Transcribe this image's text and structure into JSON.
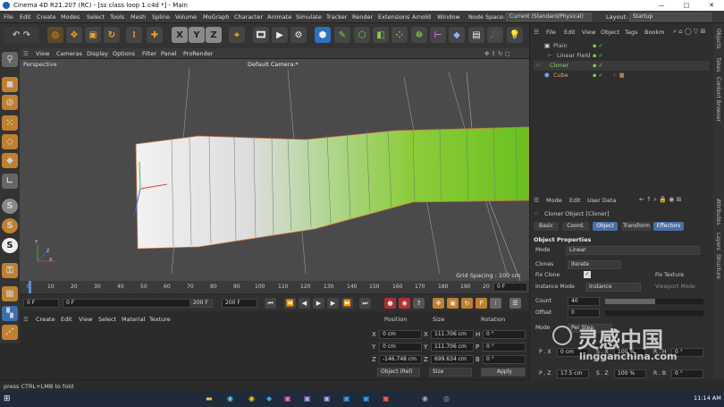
{
  "window": {
    "title": "Cinema 4D R21.207 (RC) - [ss class loop 1.c4d *] - Main",
    "min": "—",
    "max": "□",
    "close": "✕"
  },
  "menu": {
    "items": [
      "File",
      "Edit",
      "Create",
      "Modes",
      "Select",
      "Tools",
      "Mesh",
      "Spline",
      "Volume",
      "MoGraph",
      "Character",
      "Animate",
      "Simulate",
      "Tracker",
      "Render",
      "Extensions",
      "Arnold",
      "Window"
    ],
    "node_space_label": "Node Space:",
    "node_space_value": "Current (Standard/Physical)",
    "layout_label": "Layout:",
    "layout_value": "Startup"
  },
  "viewport": {
    "menu": [
      "View",
      "Cameras",
      "Display",
      "Options",
      "Filter",
      "Panel",
      "ProRender"
    ],
    "name": "Perspective",
    "camera": "Default Camera:*",
    "grid": "Grid Spacing : 100 cm",
    "axis_z": "Z",
    "axis_x": "X",
    "axis_y": "Y"
  },
  "timeline": {
    "ticks": [
      "0",
      "10",
      "20",
      "30",
      "40",
      "50",
      "60",
      "70",
      "80",
      "90",
      "100",
      "110",
      "120",
      "130",
      "140",
      "150",
      "160",
      "170",
      "180",
      "190",
      "20"
    ],
    "current": "0 F"
  },
  "transport": {
    "start": "0 F",
    "current": "0 F",
    "end1": "200 F",
    "end2": "200 F"
  },
  "materials": {
    "menu": [
      "Create",
      "Edit",
      "View",
      "Select",
      "Material",
      "Texture"
    ]
  },
  "coords": {
    "headers": [
      "Position",
      "Size",
      "Rotation"
    ],
    "rows": [
      {
        "axis": "X",
        "pos": "0 cm",
        "saxis": "X",
        "size": "111.706 cm",
        "raxis": "H",
        "rot": "0 °"
      },
      {
        "axis": "Y",
        "pos": "0 cm",
        "saxis": "Y",
        "size": "111.706 cm",
        "raxis": "P",
        "rot": "0 °"
      },
      {
        "axis": "Z",
        "pos": "-146.748 cm",
        "saxis": "Z",
        "size": "699.634 cm",
        "raxis": "B",
        "rot": "0 °"
      }
    ],
    "mode": "Object (Rel)",
    "size_mode": "Size",
    "apply": "Apply"
  },
  "status": {
    "text": "press CTRL+LMB to fold"
  },
  "objmgr": {
    "menu": [
      "File",
      "Edit",
      "View",
      "Object",
      "Tags",
      "Bookm"
    ],
    "objects": [
      {
        "name": "Plain",
        "indent": 1,
        "color": "#bdbdbd"
      },
      {
        "name": "Linear Field",
        "indent": 2,
        "color": "#bdbdbd"
      },
      {
        "name": "Cloner",
        "indent": 0,
        "color": "#8fd06a"
      },
      {
        "name": "Cube",
        "indent": 1,
        "color": "#e0a060"
      }
    ]
  },
  "attr": {
    "menu": [
      "Mode",
      "Edit",
      "User Data"
    ],
    "object_title": "Cloner Object [Cloner]",
    "tabs": [
      "Basic",
      "Coord.",
      "Object",
      "Transform",
      "Effectors"
    ],
    "section": "Object Properties",
    "mode_label": "Mode",
    "mode_value": "Linear",
    "clones_label": "Clones",
    "clones_value": "Iterate",
    "fixclone_label": "Fix Clone",
    "fixtex_label": "Fix Texture",
    "instmode_label": "Instance Mode",
    "instmode_value": "Instance",
    "viewport_mode": "Viewport Mode",
    "count_label": "Count",
    "count_value": "40",
    "offset_label": "Offset",
    "offset_value": "0",
    "mode2_label": "Mode",
    "mode2_value": "Per Step",
    "px_label": "P . X",
    "px_value": "0 cm",
    "sx_label": "S . X",
    "sx_value": "100 %",
    "rh_label": "R . H",
    "rh_value": "0 °",
    "pz_label": "P . Z",
    "pz_value": "17.5 cm",
    "sz_label": "S . Z",
    "sz_value": "100 %",
    "rb_label": "R . B",
    "rb_value": "0 °"
  },
  "rightstrip": [
    "Objects",
    "Takes",
    "Content Browser",
    "Attributes",
    "Layers",
    "Structure"
  ],
  "taskbar": {
    "time": "11:14 AM"
  },
  "watermark": {
    "text": "灵感中国",
    "url": "lingganchina.com"
  }
}
